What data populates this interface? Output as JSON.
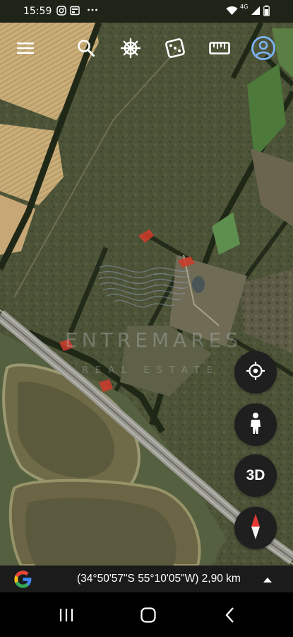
{
  "status_bar": {
    "time": "15:59",
    "icons": [
      "instagram-icon",
      "screen-share-icon",
      "more-dots-icon",
      "wifi-icon",
      "4g-icon",
      "signal-icon",
      "battery-icon"
    ],
    "network_label": "4G"
  },
  "toolbar": {
    "icons": [
      "menu-icon",
      "search-icon",
      "voyager-ship-wheel-icon",
      "dice-icon",
      "ruler-icon",
      "account-icon"
    ]
  },
  "map": {
    "type": "satellite",
    "accent_color": "#7ab4f5"
  },
  "watermark": {
    "title": "ENTREMARES",
    "subtitle": "REAL ESTATE"
  },
  "controls": {
    "my_location_icon": "target-icon",
    "street_view_icon": "pegman-icon",
    "three_d_label": "3D",
    "compass_icon": "compass-icon"
  },
  "info_bar": {
    "logo": "google-g-logo",
    "coordinates": "(34°50'57\"S 55°10'05\"W) 2,90 km",
    "expand_icon": "caret-up-icon"
  },
  "nav_bar": {
    "icons": [
      "recents-icon",
      "home-icon",
      "back-icon"
    ]
  }
}
